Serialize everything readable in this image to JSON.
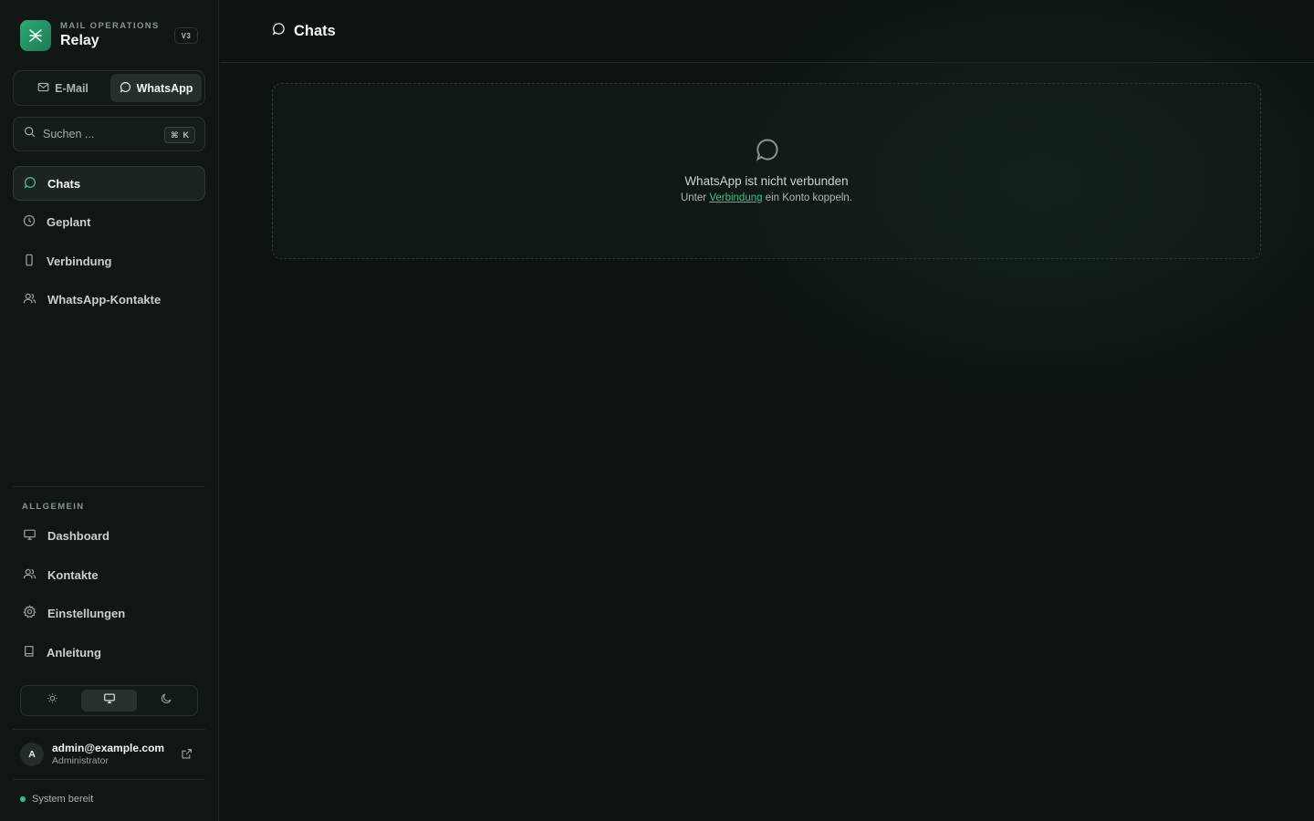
{
  "brand": {
    "subtitle": "MAIL OPERATIONS",
    "name": "Relay",
    "version": "V3"
  },
  "channels": {
    "email": "E-Mail",
    "whatsapp": "WhatsApp",
    "active": "whatsapp"
  },
  "search": {
    "placeholder": "Suchen ...",
    "shortcut_symbol": "⌘",
    "shortcut_key": "K"
  },
  "nav": {
    "items": [
      {
        "label": "Chats",
        "icon": "chat-bubble-icon",
        "active": true
      },
      {
        "label": "Geplant",
        "icon": "clock-icon"
      },
      {
        "label": "Verbindung",
        "icon": "smartphone-icon"
      },
      {
        "label": "WhatsApp-Kontakte",
        "icon": "users-icon"
      }
    ]
  },
  "general": {
    "section_label": "ALLGEMEIN",
    "items": [
      {
        "label": "Dashboard",
        "icon": "monitor-icon"
      },
      {
        "label": "Kontakte",
        "icon": "users-icon"
      },
      {
        "label": "Einstellungen",
        "icon": "gear-icon"
      },
      {
        "label": "Anleitung",
        "icon": "book-icon"
      }
    ]
  },
  "theme": {
    "options": [
      "sun-icon",
      "monitor-icon",
      "moon-icon"
    ],
    "active": "monitor-icon"
  },
  "user": {
    "initial": "A",
    "email": "admin@example.com",
    "role": "Administrator"
  },
  "status": {
    "text": "System bereit",
    "color": "#34c287"
  },
  "page": {
    "title": "Chats"
  },
  "empty_state": {
    "title": "WhatsApp ist nicht verbunden",
    "sub_prefix": "Unter",
    "sub_link": "Verbindung",
    "sub_suffix": "ein Konto koppeln."
  },
  "colors": {
    "accent": "#3fbf8b",
    "brand": "#2ea878",
    "background": "#0c1311"
  }
}
